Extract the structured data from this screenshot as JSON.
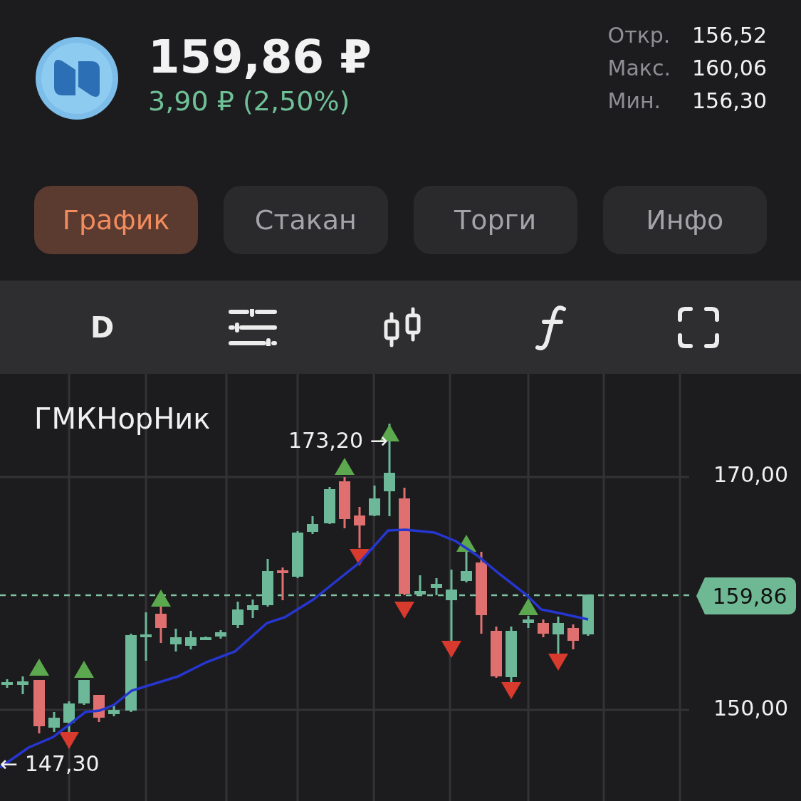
{
  "header": {
    "price": "159,86 ₽",
    "change": "3,90 ₽ (2,50%)",
    "stats": [
      {
        "label": "Откр.",
        "value": "156,52"
      },
      {
        "label": "Макс.",
        "value": "160,06"
      },
      {
        "label": "Мин.",
        "value": "156,30"
      }
    ]
  },
  "tabs": [
    {
      "label": "График",
      "selected": true
    },
    {
      "label": "Стакан",
      "selected": false
    },
    {
      "label": "Торги",
      "selected": false
    },
    {
      "label": "Инфо",
      "selected": false
    }
  ],
  "toolbar": {
    "period": "D"
  },
  "chart": {
    "ticker": "ГМКНорНик",
    "y_labels": [
      "170,00",
      "150,00"
    ],
    "current_price": "159,86",
    "high_label": "173,20 →",
    "low_label": "← 147,30"
  }
}
